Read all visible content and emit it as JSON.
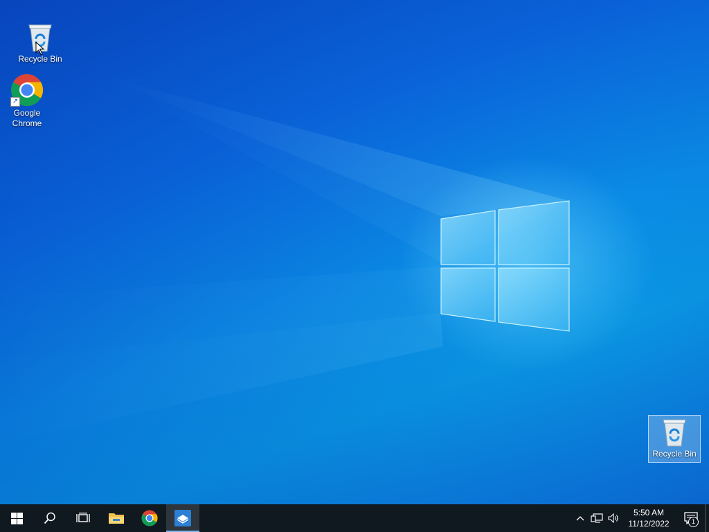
{
  "desktop": {
    "icons": [
      {
        "label": "Recycle Bin",
        "icon": "recycle-bin-icon"
      },
      {
        "label": "Google\nChrome",
        "icon": "chrome-icon"
      },
      {
        "label": "Recycle Bin",
        "icon": "recycle-bin-icon",
        "selected": true
      }
    ]
  },
  "taskbar": {
    "buttons": [
      {
        "icon": "windows-start-icon"
      },
      {
        "icon": "search-icon"
      },
      {
        "icon": "task-view-icon"
      },
      {
        "icon": "file-explorer-icon"
      },
      {
        "icon": "chrome-icon"
      },
      {
        "icon": "app-icon",
        "active": true
      }
    ],
    "tray": {
      "icons": [
        "chevron-up-icon",
        "network-icon",
        "volume-icon"
      ],
      "time": "5:50 AM",
      "date": "11/12/2022",
      "notification_count": "1"
    }
  },
  "colors": {
    "taskbar_bg": "#101820",
    "accent": "#0a78e0"
  }
}
